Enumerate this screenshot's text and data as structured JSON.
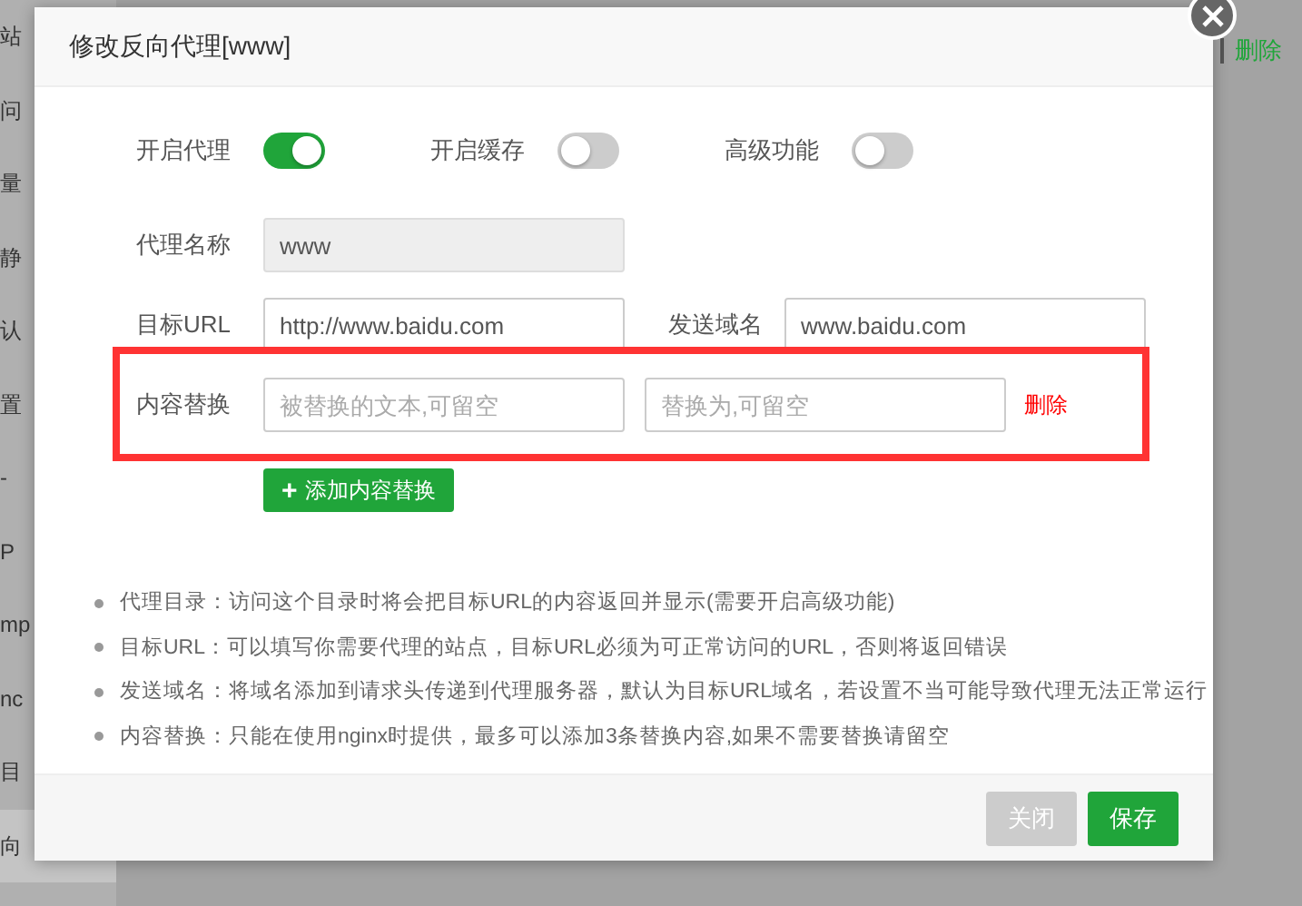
{
  "background": {
    "sidebar_items": [
      {
        "label": "站",
        "selected": false
      },
      {
        "label": "问",
        "selected": false
      },
      {
        "label": "量",
        "selected": false
      },
      {
        "label": "静",
        "selected": false
      },
      {
        "label": "认",
        "selected": false
      },
      {
        "label": "置",
        "selected": false
      },
      {
        "label": "-",
        "selected": false
      },
      {
        "label": "P",
        "selected": false
      },
      {
        "label": "mp",
        "selected": false
      },
      {
        "label": "nc",
        "selected": false
      },
      {
        "label": "目",
        "selected": false
      },
      {
        "label": "向",
        "selected": true
      }
    ],
    "row_action": "删除"
  },
  "dialog": {
    "title": "修改反向代理[www]",
    "toggles": [
      {
        "label": "开启代理",
        "on": true
      },
      {
        "label": "开启缓存",
        "on": false
      },
      {
        "label": "高级功能",
        "on": false
      }
    ],
    "proxy_name": {
      "label": "代理名称",
      "value": "www",
      "disabled": true
    },
    "target_url": {
      "label": "目标URL",
      "value": "http://www.baidu.com"
    },
    "send_domain": {
      "label": "发送域名",
      "value": "www.baidu.com"
    },
    "content_replace": {
      "label": "内容替换",
      "highlighted": true,
      "find_placeholder": "被替换的文本,可留空",
      "replace_placeholder": "替换为,可留空",
      "delete": "删除"
    },
    "add_button": {
      "icon": "+",
      "label": "添加内容替换"
    },
    "notes": [
      "代理目录：访问这个目录时将会把目标URL的内容返回并显示(需要开启高级功能)",
      "目标URL：可以填写你需要代理的站点，目标URL必须为可正常访问的URL，否则将返回错误",
      "发送域名：将域名添加到请求头传递到代理服务器，默认为目标URL域名，若设置不当可能导致代理无法正常运行",
      "内容替换：只能在使用nginx时提供，最多可以添加3条替换内容,如果不需要替换请留空"
    ],
    "buttons": [
      {
        "label": "关闭",
        "kind": "secondary"
      },
      {
        "label": "保存",
        "kind": "primary"
      }
    ]
  }
}
